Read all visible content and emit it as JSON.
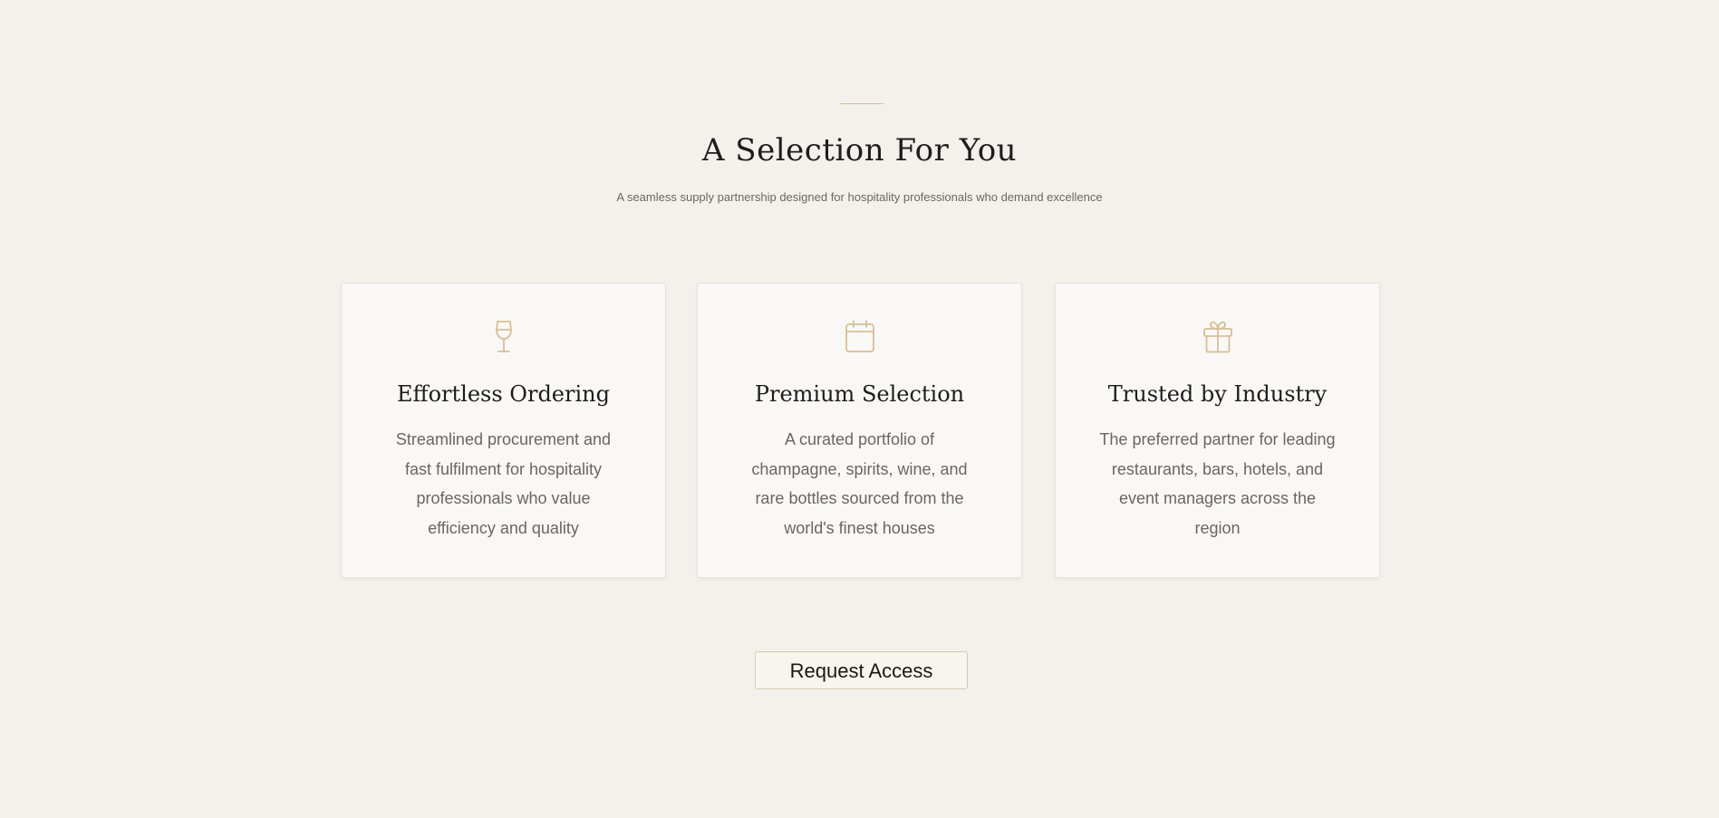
{
  "section": {
    "title": "A Selection For You",
    "subtitle": "A seamless supply partnership designed for hospitality professionals who demand excellence"
  },
  "accent_color": "#d6bf96",
  "cards": [
    {
      "icon": "wine-glass-icon",
      "title": "Effortless Ordering",
      "text": "Streamlined procurement and fast fulfilment for hospitality professionals who value efficiency and quality"
    },
    {
      "icon": "calendar-icon",
      "title": "Premium Selection",
      "text": "A curated portfolio of champagne, spirits, wine, and rare bottles sourced from the world's finest houses"
    },
    {
      "icon": "gift-icon",
      "title": "Trusted by Industry",
      "text": "The preferred partner for leading restaurants, bars, hotels, and event managers across the region"
    }
  ],
  "cta": {
    "label": "Request Access"
  }
}
